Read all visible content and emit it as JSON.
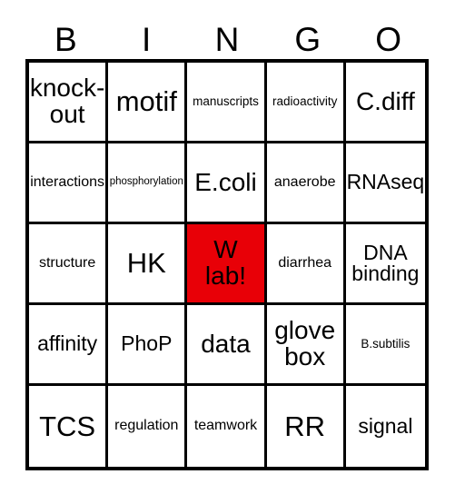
{
  "card": {
    "title": "BINGO card",
    "header_letters": [
      "B",
      "I",
      "N",
      "G",
      "O"
    ],
    "marked_color": "#e80007",
    "text_color": "#000000",
    "background_color": "#ffffff",
    "border_color": "#000000",
    "rows": 5,
    "columns": 5,
    "cells": [
      [
        {
          "text": "knock-\nout",
          "size": "lg",
          "marked": false
        },
        {
          "text": "motif",
          "size": "xl",
          "marked": false
        },
        {
          "text": "manuscripts",
          "size": "xs",
          "marked": false
        },
        {
          "text": "radioactivity",
          "size": "xs",
          "marked": false
        },
        {
          "text": "C.diff",
          "size": "lg",
          "marked": false
        }
      ],
      [
        {
          "text": "interactions",
          "size": "sm",
          "marked": false
        },
        {
          "text": "phosphorylation",
          "size": "xxs",
          "marked": false
        },
        {
          "text": "E.coli",
          "size": "lg",
          "marked": false
        },
        {
          "text": "anaerobe",
          "size": "sm",
          "marked": false
        },
        {
          "text": "RNAseq",
          "size": "md",
          "marked": false
        }
      ],
      [
        {
          "text": "structure",
          "size": "sm",
          "marked": false
        },
        {
          "text": "HK",
          "size": "xl",
          "marked": false
        },
        {
          "text": "W\nlab!",
          "size": "lg",
          "marked": true
        },
        {
          "text": "diarrhea",
          "size": "sm",
          "marked": false
        },
        {
          "text": "DNA\nbinding",
          "size": "md",
          "marked": false
        }
      ],
      [
        {
          "text": "affinity",
          "size": "md",
          "marked": false
        },
        {
          "text": "PhoP",
          "size": "md",
          "marked": false
        },
        {
          "text": "data",
          "size": "lg",
          "marked": false
        },
        {
          "text": "glove\nbox",
          "size": "lg",
          "marked": false
        },
        {
          "text": "B.subtilis",
          "size": "xs",
          "marked": false
        }
      ],
      [
        {
          "text": "TCS",
          "size": "xl",
          "marked": false
        },
        {
          "text": "regulation",
          "size": "sm",
          "marked": false
        },
        {
          "text": "teamwork",
          "size": "sm",
          "marked": false
        },
        {
          "text": "RR",
          "size": "xl",
          "marked": false
        },
        {
          "text": "signal",
          "size": "md",
          "marked": false
        }
      ]
    ]
  }
}
